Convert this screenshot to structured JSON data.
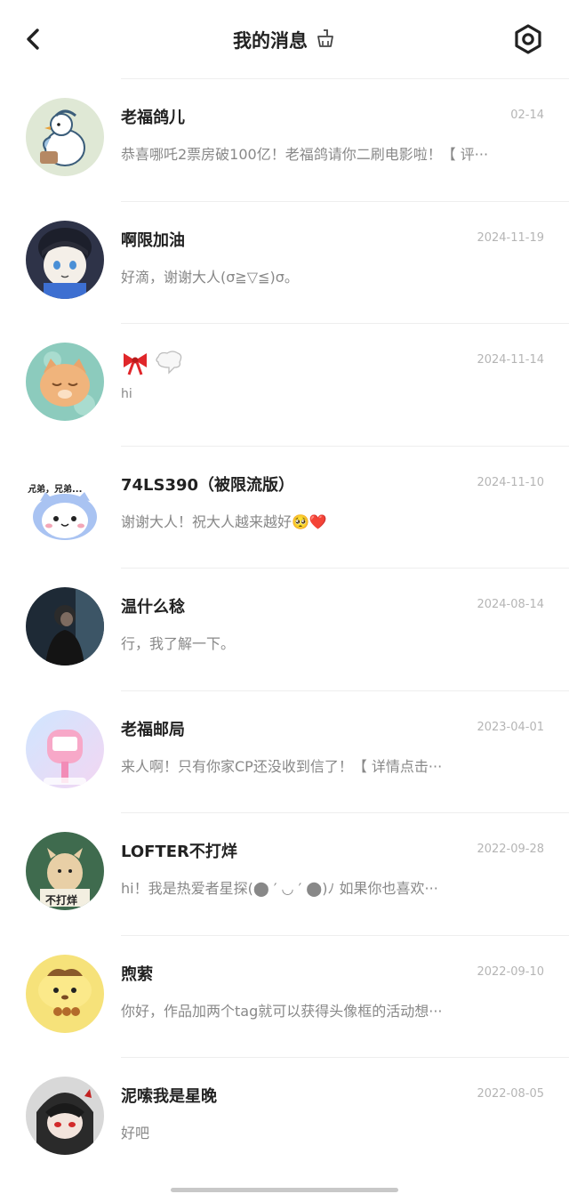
{
  "header": {
    "title": "我的消息",
    "back_icon": "chevron-left-icon",
    "broom_icon": "broom-icon",
    "settings_icon": "settings-icon"
  },
  "messages": [
    {
      "name": "老福鸽儿",
      "date": "02-14",
      "preview": "恭喜哪吒2票房破100亿！老福鸽请你二刷电影啦！【 评···",
      "avatar": "pigeon-avatar",
      "color": "#dfe7d6"
    },
    {
      "name": "啊限加油",
      "date": "2024-11-19",
      "preview": "好滴，谢谢大人(σ≧▽≦)σ。",
      "avatar": "plush-avatar",
      "color": "#3a3f57"
    },
    {
      "name": "🎀💭",
      "date": "2024-11-14",
      "preview": "hi",
      "avatar": "cat-avatar",
      "color": "#8fc7c0"
    },
    {
      "name": "74LS390（被限流版）",
      "date": "2024-11-10",
      "preview": "谢谢大人！祝大人越来越好🥺❤️",
      "avatar": "hamster-avatar",
      "color": "#eef3ff",
      "avatar_text": "兄弟，兄弟..."
    },
    {
      "name": "温什么稔",
      "date": "2024-08-14",
      "preview": "行，我了解一下。",
      "avatar": "person-avatar",
      "color": "#1f2a35"
    },
    {
      "name": "老福邮局",
      "date": "2023-04-01",
      "preview": "来人啊！只有你家CP还没收到信了！【 详情点击···",
      "avatar": "mailbox-avatar",
      "color": "#d8e9ff"
    },
    {
      "name": "LOFTER不打烊",
      "date": "2022-09-28",
      "preview": "hi！我是热爱者星探(⬤ ′ ◡ ′ ⬤)ﾉ 如果你也喜欢···",
      "avatar": "alpaca-avatar",
      "color": "#3f6b4e",
      "avatar_text": "不打烊"
    },
    {
      "name": "煦萦",
      "date": "2022-09-10",
      "preview": "你好，作品加两个tag就可以获得头像框的活动想···",
      "avatar": "pompompurin-avatar",
      "color": "#f6e27a"
    },
    {
      "name": "泥嗦我是星晚",
      "date": "2022-08-05",
      "preview": "好吧",
      "avatar": "anime-avatar",
      "color": "#3a3a3a"
    }
  ]
}
